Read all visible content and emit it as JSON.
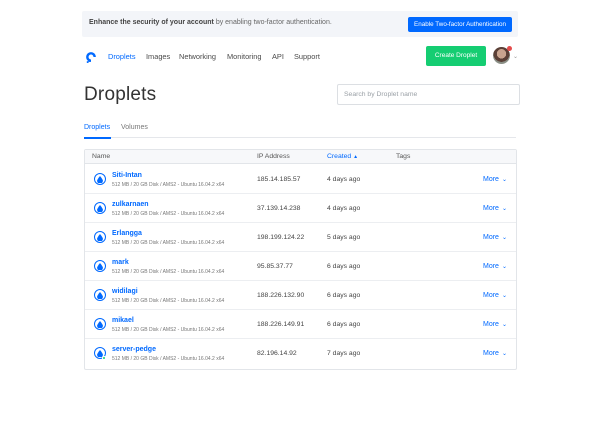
{
  "banner": {
    "bold_text": "Enhance the security of your account",
    "text": " by enabling two-factor authentication.",
    "button_label": "Enable Two-factor Authentication"
  },
  "nav": {
    "items": [
      {
        "label": "Droplets",
        "active": true
      },
      {
        "label": "Images"
      },
      {
        "label": "Networking"
      },
      {
        "label": "Monitoring"
      },
      {
        "label": "API"
      },
      {
        "label": "Support"
      }
    ],
    "create_label": "Create Droplet",
    "logo_icon": "digitalocean-logo-icon",
    "avatar_caret": "⌄"
  },
  "page": {
    "title": "Droplets",
    "search_placeholder": "Search by Droplet name"
  },
  "tabs": [
    {
      "label": "Droplets",
      "active": true
    },
    {
      "label": "Volumes"
    }
  ],
  "table": {
    "headers": {
      "name": "Name",
      "ip": "IP Address",
      "created": "Created",
      "sort_indicator": "▲",
      "tags": "Tags"
    },
    "more_label": "More",
    "more_caret": "⌄",
    "rows": [
      {
        "name": "Siti-Intan",
        "meta": "512 MB / 20 GB Disk / AMS2 - Ubuntu 16.04.2 x64",
        "ip": "185.14.185.57",
        "created": "4 days ago"
      },
      {
        "name": "zulkarnaen",
        "meta": "512 MB / 20 GB Disk / AMS2 - Ubuntu 16.04.2 x64",
        "ip": "37.139.14.238",
        "created": "4 days ago"
      },
      {
        "name": "Erlangga",
        "meta": "512 MB / 20 GB Disk / AMS2 - Ubuntu 16.04.2 x64",
        "ip": "198.199.124.22",
        "created": "5 days ago"
      },
      {
        "name": "mark",
        "meta": "512 MB / 20 GB Disk / AMS2 - Ubuntu 16.04.2 x64",
        "ip": "95.85.37.77",
        "created": "6 days ago"
      },
      {
        "name": "widilagi",
        "meta": "512 MB / 20 GB Disk / AMS2 - Ubuntu 16.04.2 x64",
        "ip": "188.226.132.90",
        "created": "6 days ago"
      },
      {
        "name": "mikael",
        "meta": "512 MB / 20 GB Disk / AMS2 - Ubuntu 16.04.2 x64",
        "ip": "188.226.149.91",
        "created": "6 days ago"
      },
      {
        "name": "server-pedge",
        "meta": "512 MB / 20 GB Disk / AMS2 - Ubuntu 16.04.2 x64",
        "ip": "82.196.14.92",
        "created": "7 days ago",
        "status": "active"
      }
    ]
  },
  "colors": {
    "accent": "#0069ff",
    "create_button": "#15cd72",
    "banner_bg": "#f3f5f9"
  }
}
